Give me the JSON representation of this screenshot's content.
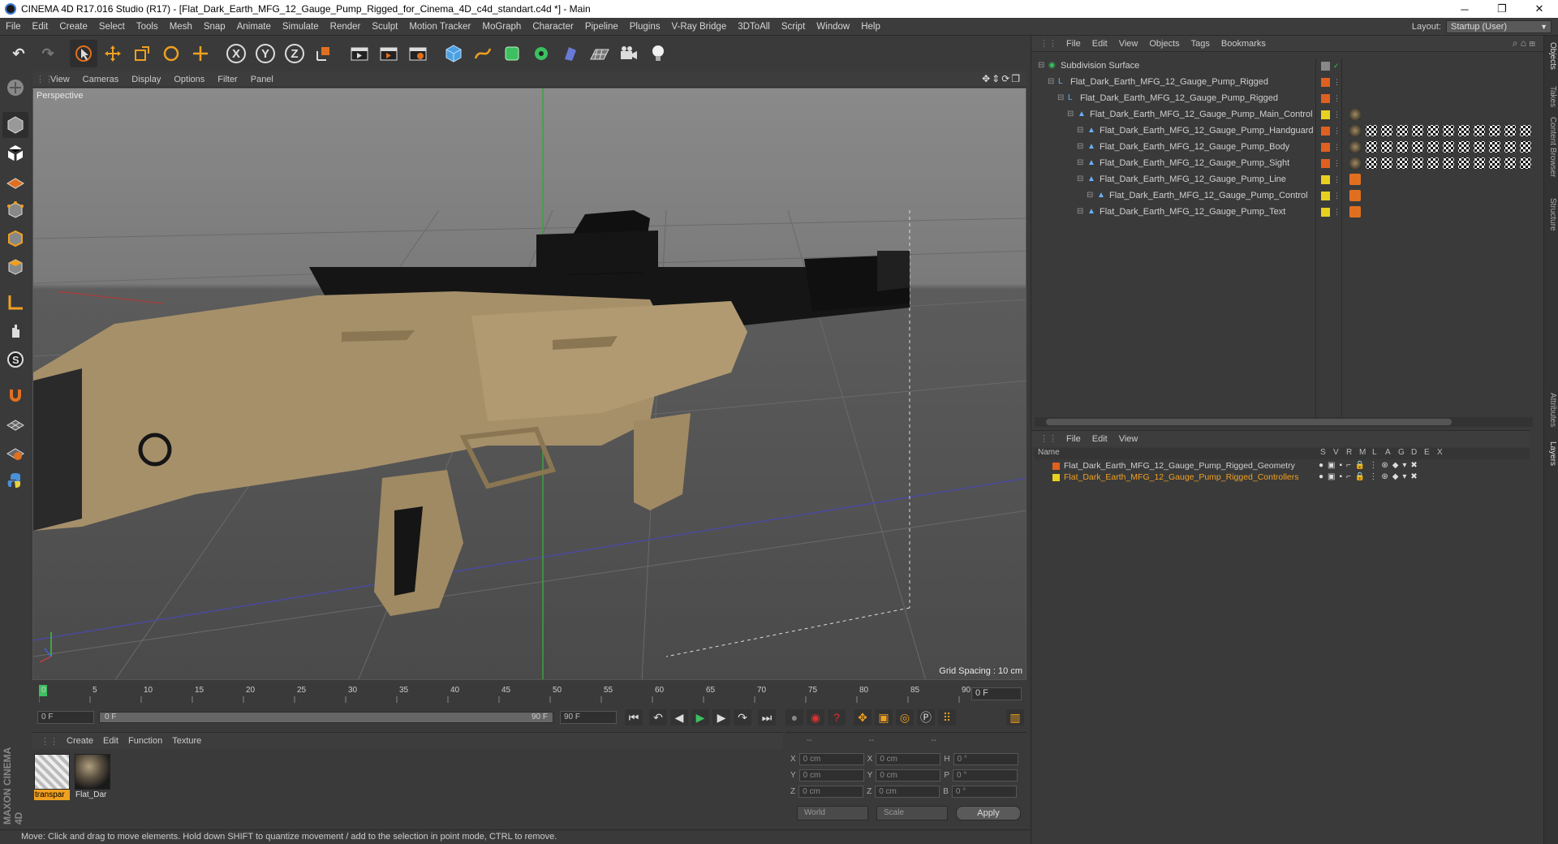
{
  "window": {
    "title": "CINEMA 4D R17.016 Studio (R17) - [Flat_Dark_Earth_MFG_12_Gauge_Pump_Rigged_for_Cinema_4D_c4d_standart.c4d *] - Main",
    "minimize": "─",
    "maximize": "❐",
    "close": "✕"
  },
  "menubar": {
    "items": [
      "File",
      "Edit",
      "Create",
      "Select",
      "Tools",
      "Mesh",
      "Snap",
      "Animate",
      "Simulate",
      "Render",
      "Sculpt",
      "Motion Tracker",
      "MoGraph",
      "Character",
      "Pipeline",
      "Plugins",
      "V-Ray Bridge",
      "3DToAll",
      "Script",
      "Window",
      "Help"
    ],
    "layout_label": "Layout:",
    "layout_value": "Startup (User)"
  },
  "toolbar": {
    "axis_x": "X",
    "axis_y": "Y",
    "axis_z": "Z"
  },
  "viewport": {
    "menu": [
      "View",
      "Cameras",
      "Display",
      "Options",
      "Filter",
      "Panel"
    ],
    "label": "Perspective",
    "grid_spacing": "Grid Spacing : 10 cm"
  },
  "timeline": {
    "ticks": [
      "0",
      "5",
      "10",
      "15",
      "20",
      "25",
      "30",
      "35",
      "40",
      "45",
      "50",
      "55",
      "60",
      "65",
      "70",
      "75",
      "80",
      "85",
      "90"
    ],
    "current_frame": "0 F",
    "start_field": "0 F",
    "slider_start": "0 F",
    "slider_end": "90 F",
    "end_field": "90 F"
  },
  "materials": {
    "menu": [
      "Create",
      "Edit",
      "Function",
      "Texture"
    ],
    "items": [
      {
        "name": "transpar"
      },
      {
        "name": "Flat_Dar"
      }
    ]
  },
  "coordinates": {
    "headers": [
      "--",
      "--",
      "--"
    ],
    "rows": [
      {
        "a": "X",
        "av": "0 cm",
        "b": "X",
        "bv": "0 cm",
        "c": "H",
        "cv": "0 °"
      },
      {
        "a": "Y",
        "av": "0 cm",
        "b": "Y",
        "bv": "0 cm",
        "c": "P",
        "cv": "0 °"
      },
      {
        "a": "Z",
        "av": "0 cm",
        "b": "Z",
        "bv": "0 cm",
        "c": "B",
        "cv": "0 °"
      }
    ],
    "world": "World",
    "scale": "Scale",
    "apply": "Apply"
  },
  "logo": {
    "text": "MAXON CINEMA 4D"
  },
  "status": "Move: Click and drag to move elements. Hold down SHIFT to quantize movement / add to the selection in point mode, CTRL to remove.",
  "objects": {
    "menu": [
      "File",
      "Edit",
      "View",
      "Objects",
      "Tags",
      "Bookmarks"
    ],
    "tree": [
      {
        "name": "Subdivision Surface",
        "indent": 0,
        "color": "#888888"
      },
      {
        "name": "Flat_Dark_Earth_MFG_12_Gauge_Pump_Rigged",
        "indent": 1,
        "color": "#e06020"
      },
      {
        "name": "Flat_Dark_Earth_MFG_12_Gauge_Pump_Rigged",
        "indent": 2,
        "color": "#e06020"
      },
      {
        "name": "Flat_Dark_Earth_MFG_12_Gauge_Pump_Main_Control",
        "indent": 3,
        "color": "#e8d020"
      },
      {
        "name": "Flat_Dark_Earth_MFG_12_Gauge_Pump_Handguard",
        "indent": 4,
        "color": "#e06020"
      },
      {
        "name": "Flat_Dark_Earth_MFG_12_Gauge_Pump_Body",
        "indent": 4,
        "color": "#e06020"
      },
      {
        "name": "Flat_Dark_Earth_MFG_12_Gauge_Pump_Sight",
        "indent": 4,
        "color": "#e06020"
      },
      {
        "name": "Flat_Dark_Earth_MFG_12_Gauge_Pump_Line",
        "indent": 4,
        "color": "#e8d020"
      },
      {
        "name": "Flat_Dark_Earth_MFG_12_Gauge_Pump_Control",
        "indent": 5,
        "color": "#e8d020"
      },
      {
        "name": "Flat_Dark_Earth_MFG_12_Gauge_Pump_Text",
        "indent": 4,
        "color": "#e8d020"
      }
    ]
  },
  "layers": {
    "menu": [
      "File",
      "Edit",
      "View"
    ],
    "header_name": "Name",
    "header_cols": [
      "S",
      "V",
      "R",
      "M",
      "L",
      "A",
      "G",
      "D",
      "E",
      "X"
    ],
    "rows": [
      {
        "name": "Flat_Dark_Earth_MFG_12_Gauge_Pump_Rigged_Geometry",
        "color": "#e06020",
        "text_color": "#d0d0d0"
      },
      {
        "name": "Flat_Dark_Earth_MFG_12_Gauge_Pump_Rigged_Controllers",
        "color": "#e8d020",
        "text_color": "#f0a020"
      }
    ]
  },
  "side_tabs": [
    "Objects",
    "Takes",
    "Content Browser",
    "Structure",
    "Attributes",
    "Layers"
  ]
}
